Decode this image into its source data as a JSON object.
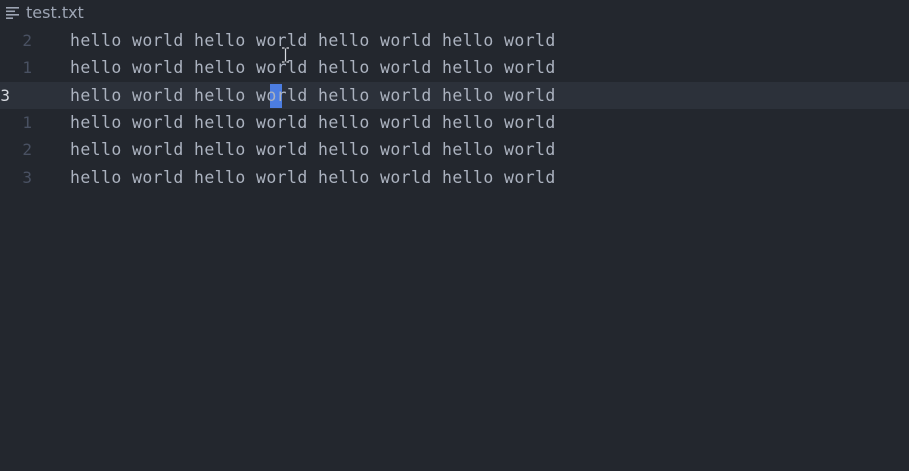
{
  "tab": {
    "title": "test.txt",
    "icon": "file-text-icon"
  },
  "editor": {
    "lines": [
      {
        "number": "2",
        "text": "hello world hello world hello world hello world",
        "current": false
      },
      {
        "number": "1",
        "text": "hello world hello world hello world hello world",
        "current": false
      },
      {
        "number": "3",
        "text": "hello world hello world hello world hello world",
        "current": true
      },
      {
        "number": "1",
        "text": "hello world hello world hello world hello world",
        "current": false
      },
      {
        "number": "2",
        "text": "hello world hello world hello world hello world",
        "current": false
      },
      {
        "number": "3",
        "text": "hello world hello world hello world hello world",
        "current": false
      }
    ]
  },
  "colors": {
    "background": "#23272e",
    "current_line": "#2c313a",
    "text": "#abb2bf",
    "gutter": "#495162",
    "selection": "#528bff"
  }
}
